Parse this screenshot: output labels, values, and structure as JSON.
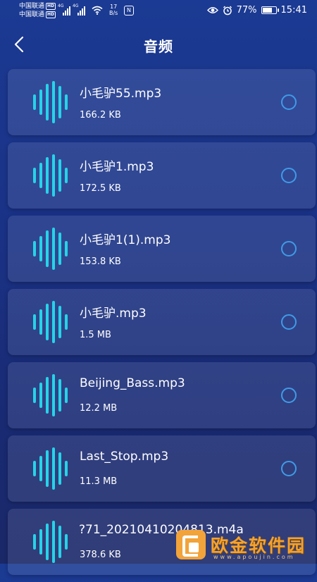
{
  "status_bar": {
    "carrier1": "中国联通",
    "carrier2": "中国联通",
    "hd": "HD",
    "net_type": "4G",
    "net_speed_value": "17",
    "net_speed_unit": "B/s",
    "nfc": "N",
    "battery": "77%",
    "battery_level": 0.77,
    "time": "15:41"
  },
  "header": {
    "title": "音频",
    "back_icon": "chevron-left-icon"
  },
  "files": [
    {
      "name": "小毛驴55.mp3",
      "size": "166.2 KB"
    },
    {
      "name": "小毛驴1.mp3",
      "size": "172.5 KB"
    },
    {
      "name": "小毛驴1(1).mp3",
      "size": "153.8 KB"
    },
    {
      "name": "小毛驴.mp3",
      "size": "1.5 MB"
    },
    {
      "name": "Beijing_Bass.mp3",
      "size": "12.2 MB"
    },
    {
      "name": "Last_Stop.mp3",
      "size": "11.3 MB"
    },
    {
      "name": "?71_20210410204813.m4a",
      "size": "378.6 KB"
    }
  ],
  "colors": {
    "accent": "#26d3e9",
    "radio": "#3f9be6",
    "background_top": "#1b3a93",
    "background_bottom": "#1a2868"
  },
  "watermark": {
    "text": "欧金软件园",
    "url": "www.apoujin.com"
  }
}
